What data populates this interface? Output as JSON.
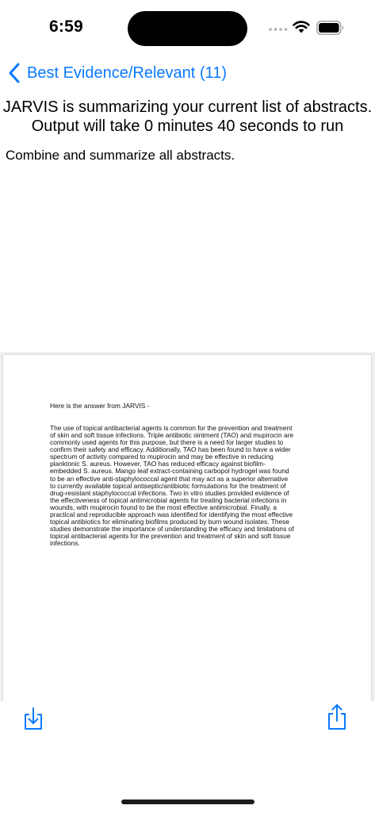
{
  "status_bar": {
    "time": "6:59"
  },
  "nav": {
    "back_label": "Best Evidence/Relevant (11)"
  },
  "header": {
    "line1": "JARVIS is summarizing your current list of abstracts.",
    "line2": "Output will take 0 minutes 40 seconds to run"
  },
  "instruction": "Combine and summarize all abstracts.",
  "document": {
    "intro": "Here is the answer from JARVIS -",
    "lines": [
      "The use of topical antibacterial agents is common for the prevention and treatment",
      "of skin and soft tissue infections. Triple antibiotic ointment (TAO) and mupirocin are",
      "commonly used agents for this purpose, but there is a need for larger studies to",
      "confirm their safety and efficacy. Additionally, TAO has been found to have a wider",
      "spectrum of activity compared to mupirocin and may be effective in reducing",
      "planktonic S. aureus. However, TAO has reduced efficacy against biofilm-",
      "embedded S. aureus. Mango leaf extract-containing carbopol hydrogel was found",
      "to be an effective anti-staphylococcal agent that may act as a superior alternative",
      "to currently available topical antiseptic/antibiotic formulations for the treatment of",
      "drug-resistant staphylococcal infections. Two in vitro studies provided evidence of",
      "the effectiveness of topical antimicrobial agents for treating bacterial infections in",
      "wounds, with mupirocin found to be the most effective antimicrobial. Finally, a",
      "practical and reproducible approach was identified for identifying the most effective",
      "topical antibiotics for eliminating biofilms produced by burn wound isolates. These",
      "studies demonstrate the importance of understanding the efficacy and limitations of",
      "topical antibacterial agents for the prevention and treatment of skin and soft tissue",
      "infections."
    ]
  },
  "toolbar": {
    "download_icon": "download-icon",
    "share_icon": "share-icon"
  },
  "colors": {
    "accent": "#0a7aff"
  }
}
